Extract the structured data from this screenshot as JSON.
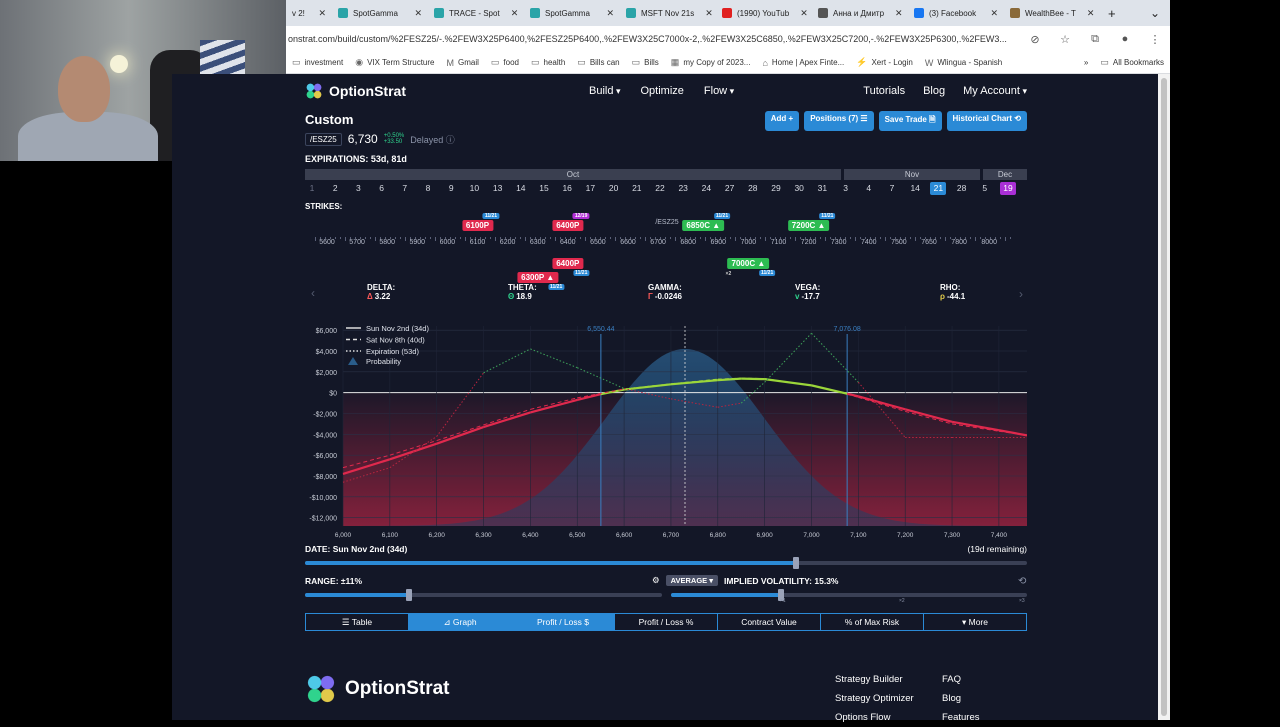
{
  "browser": {
    "tabs": [
      {
        "label": "v 2!",
        "color": "#dee3ea"
      },
      {
        "label": "SpotGamma",
        "color": "#2aa4a8"
      },
      {
        "label": "TRACE - Spot",
        "color": "#2aa4a8"
      },
      {
        "label": "SpotGamma",
        "color": "#2aa4a8"
      },
      {
        "label": "MSFT Nov 21s",
        "color": "#2aa4a8"
      },
      {
        "label": "(1990) YouTub",
        "color": "#e02020"
      },
      {
        "label": "Анна и Дмитр",
        "color": "#555555"
      },
      {
        "label": "(3) Facebook",
        "color": "#1877f2"
      },
      {
        "label": "WealthBee - T",
        "color": "#8a6a3a"
      }
    ],
    "url": "onstrat.com/build/custom/%2FESZ25/-.%2FEW3X25P6400,%2FESZ25P6400,.%2FEW3X25C7000x-2,.%2FEW3X25C6850,.%2FEW3X25C7200,-.%2FEW3X25P6300,.%2FEW3...",
    "bookmarks": [
      "investment",
      "VIX Term Structure",
      "Gmail",
      "food",
      "health",
      "Bills can",
      "Bills",
      "my Copy of 2023...",
      "Home | Apex Finte...",
      "Xert - Login",
      "Wlingua - Spanish"
    ],
    "all_bookmarks": "All Bookmarks"
  },
  "nav": {
    "brand": "OptionStrat",
    "menu": [
      "Build",
      "Optimize",
      "Flow"
    ],
    "right": [
      "Tutorials",
      "Blog",
      "My Account"
    ]
  },
  "header": {
    "title": "Custom",
    "actions": [
      "Add +",
      "Positions (7) ☰",
      "Save Trade 🗎",
      "Historical Chart ⟲"
    ]
  },
  "quote": {
    "symbol": "/ESZ25",
    "price": "6,730",
    "change_pct": "+0.50%",
    "change_abs": "+33.50",
    "status": "Delayed"
  },
  "expirations": {
    "label": "EXPIRATIONS: 53d, 81d",
    "months": [
      "Oct",
      "Nov",
      "Dec"
    ],
    "days": [
      "1",
      "2",
      "3",
      "6",
      "7",
      "8",
      "9",
      "10",
      "13",
      "14",
      "15",
      "16",
      "17",
      "20",
      "21",
      "22",
      "23",
      "24",
      "27",
      "28",
      "29",
      "30",
      "31",
      "3",
      "4",
      "7",
      "14",
      "21",
      "28",
      "5",
      "19"
    ],
    "selected_index": 27,
    "selected2_index": 30
  },
  "strikes": {
    "label": "STRIKES:",
    "axis": [
      "5600",
      "5700",
      "5800",
      "5900",
      "6000",
      "6100",
      "6200",
      "6300",
      "6400",
      "6500",
      "6600",
      "6700",
      "6800",
      "6900",
      "7000",
      "7100",
      "7200",
      "7300",
      "7400",
      "7500",
      "7650",
      "7800",
      "8000"
    ],
    "current_label": "/ESZ25",
    "legs": [
      {
        "label": "6100P",
        "type": "red",
        "row": "top",
        "badge": "11/21",
        "badge_color": "blue",
        "strike": 6100
      },
      {
        "label": "6400P",
        "type": "red",
        "row": "top",
        "badge": "12/19",
        "badge_color": "purple",
        "strike": 6400
      },
      {
        "label": "6850C",
        "type": "green",
        "row": "top",
        "badge": "11/21",
        "badge_color": "blue",
        "strike": 6850
      },
      {
        "label": "7200C",
        "type": "green",
        "row": "top",
        "badge": "11/21",
        "badge_color": "blue",
        "strike": 7200
      },
      {
        "label": "6400P",
        "type": "red",
        "row": "bottom",
        "badge": "11/21",
        "badge_color": "blue",
        "strike": 6400
      },
      {
        "label": "6300P",
        "type": "red",
        "row": "bottom2",
        "badge": "11/21",
        "badge_color": "blue",
        "strike": 6300
      },
      {
        "label": "7000C",
        "type": "green",
        "row": "bottom",
        "badge": "11/21",
        "badge_color": "blue",
        "strike": 7000,
        "mult": "×2"
      }
    ]
  },
  "greeks": [
    {
      "name": "DELTA:",
      "symbol": "Δ",
      "value": "3.22"
    },
    {
      "name": "THETA:",
      "symbol": "Θ",
      "value": "18.9"
    },
    {
      "name": "GAMMA:",
      "symbol": "Γ",
      "value": "-0.0246"
    },
    {
      "name": "VEGA:",
      "symbol": "v",
      "value": "-17.7"
    },
    {
      "name": "RHO:",
      "symbol": "ρ",
      "value": "-44.1"
    }
  ],
  "chart_data": {
    "type": "line",
    "title": "",
    "xlabel": "",
    "ylabel": "",
    "xlim": [
      6000,
      7460
    ],
    "ylim": [
      -12800,
      6400
    ],
    "x_ticks": [
      "6,000",
      "6,100",
      "6,200",
      "6,300",
      "6,400",
      "6,500",
      "6,600",
      "6,700",
      "6,800",
      "6,900",
      "7,000",
      "7,100",
      "7,200",
      "7,300",
      "7,400"
    ],
    "y_ticks": [
      "$6,000",
      "$4,000",
      "$2,000",
      "$0",
      "-$2,000",
      "-$4,000",
      "-$6,000",
      "-$8,000",
      "-$10,000",
      "-$12,000"
    ],
    "y_tick_values": [
      6000,
      4000,
      2000,
      0,
      -2000,
      -4000,
      -6000,
      -8000,
      -10000,
      -12000
    ],
    "range_markers": [
      {
        "x": 6550.44,
        "label": "6,550.44"
      },
      {
        "x": 7076.08,
        "label": "7,076.08"
      }
    ],
    "current_price": 6730,
    "series": [
      {
        "name": "Sun Nov 2nd (34d)",
        "style": "solid",
        "x": [
          6000,
          6100,
          6200,
          6300,
          6400,
          6500,
          6550,
          6600,
          6700,
          6800,
          6850,
          6900,
          7000,
          7076,
          7100,
          7200,
          7300,
          7400,
          7460
        ],
        "y": [
          -7800,
          -6400,
          -4900,
          -3300,
          -1900,
          -700,
          -150,
          300,
          800,
          1200,
          1350,
          1300,
          700,
          -100,
          -350,
          -1600,
          -2800,
          -3600,
          -4100
        ]
      },
      {
        "name": "Sat Nov 8th (40d)",
        "style": "dashed",
        "x": [
          6000,
          6100,
          6200,
          6300,
          6400,
          6500,
          6600,
          6700,
          6800,
          6850,
          6900,
          7000,
          7076,
          7100,
          7200,
          7300,
          7400,
          7460
        ],
        "y": [
          -7200,
          -6000,
          -4600,
          -3100,
          -1600,
          -500,
          350,
          850,
          1300,
          1400,
          1350,
          700,
          -150,
          -450,
          -1800,
          -3000,
          -3700,
          -4100
        ]
      },
      {
        "name": "Expiration (53d)",
        "style": "dotted",
        "x": [
          6000,
          6100,
          6200,
          6300,
          6400,
          6500,
          6600,
          6700,
          6800,
          6850,
          6900,
          7000,
          7100,
          7200,
          7300,
          7400,
          7460
        ],
        "y": [
          -8600,
          -7200,
          -4200,
          1900,
          4200,
          2400,
          400,
          -600,
          -1400,
          -1000,
          1000,
          5700,
          1000,
          -4300,
          -4300,
          -4300,
          -4300
        ]
      }
    ],
    "probability_label": "Probability",
    "legend_position": "top-left"
  },
  "controls": {
    "date_label": "DATE: Sun Nov 2nd (34d)",
    "date_remaining": "(19d remaining)",
    "date_position": 0.68,
    "range_label": "RANGE: ±11%",
    "range_position": 0.29,
    "iv_mode": "AVERAGE",
    "iv_label": "IMPLIED VOLATILITY: 15.3%",
    "iv_position": 0.31,
    "iv_marks": [
      "×1",
      "×2",
      "×3"
    ]
  },
  "bottom_tabs": [
    {
      "label": "☰ Table",
      "active": false
    },
    {
      "label": "⊿ Graph",
      "active": true
    },
    {
      "label": "Profit / Loss $",
      "active": true
    },
    {
      "label": "Profit / Loss %",
      "active": false
    },
    {
      "label": "Contract Value",
      "active": false
    },
    {
      "label": "% of Max Risk",
      "active": false
    },
    {
      "label": "▾ More",
      "active": false
    }
  ],
  "footer": {
    "brand": "OptionStrat",
    "col1": [
      "Strategy Builder",
      "Strategy Optimizer",
      "Options Flow"
    ],
    "col2": [
      "FAQ",
      "Blog",
      "Features"
    ]
  },
  "colors": {
    "page_bg": "#131727",
    "accent": "#2b8ad6",
    "profit": "#2dbc52",
    "loss": "#e0294d"
  }
}
